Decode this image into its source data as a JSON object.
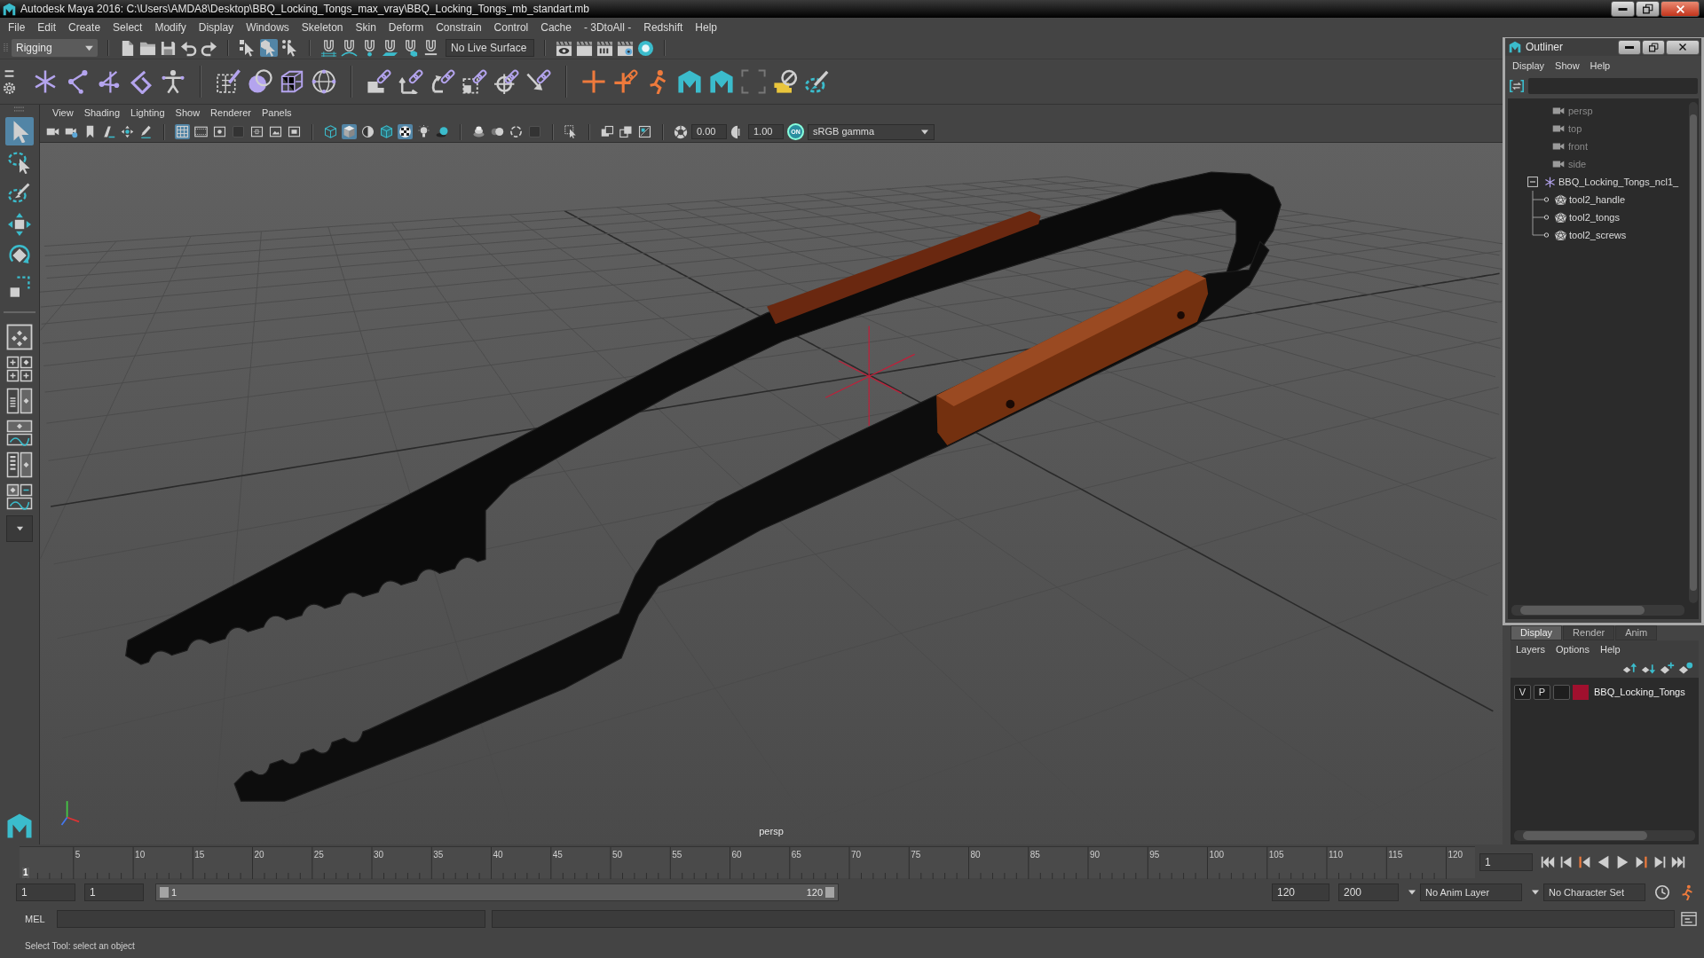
{
  "window": {
    "title": "Autodesk Maya 2016: C:\\Users\\AMDA8\\Desktop\\BBQ_Locking_Tongs_max_vray\\BBQ_Locking_Tongs_mb_standart.mb"
  },
  "menu_bar": [
    "File",
    "Edit",
    "Create",
    "Select",
    "Modify",
    "Display",
    "Windows",
    "Skeleton",
    "Skin",
    "Deform",
    "Constrain",
    "Control",
    "Cache",
    "- 3DtoAll -",
    "Redshift",
    "Help"
  ],
  "status_line": {
    "menu_set": "Rigging",
    "select_modes": [
      {
        "kind": "hierarchy",
        "selected": false
      },
      {
        "kind": "object",
        "selected": true
      },
      {
        "kind": "component",
        "selected": false
      }
    ],
    "live_surface": "No Live Surface"
  },
  "tool_box": [
    {
      "kind": "select",
      "selected": true
    },
    {
      "kind": "lasso",
      "selected": false
    },
    {
      "kind": "paint",
      "selected": false
    },
    {
      "kind": "move",
      "selected": false
    },
    {
      "kind": "rotate",
      "selected": false
    },
    {
      "kind": "scale",
      "selected": false
    }
  ],
  "viewport": {
    "menus": [
      "View",
      "Shading",
      "Lighting",
      "Show",
      "Renderer",
      "Panels"
    ],
    "toolbar": [
      [
        {
          "kind": "camera",
          "on": false
        },
        {
          "kind": "camera_attr",
          "on": false
        },
        {
          "kind": "bookmark",
          "on": false
        },
        {
          "kind": "image_plane",
          "on": false
        },
        {
          "kind": "pan_zoom",
          "on": false
        },
        {
          "kind": "grease_pencil",
          "on": false
        }
      ],
      [
        {
          "kind": "grid",
          "on": true
        },
        {
          "kind": "film_gate",
          "on": false
        },
        {
          "kind": "resolution_gate",
          "on": false
        },
        {
          "kind": "gate_mask",
          "on": false
        },
        {
          "kind": "field_chart",
          "on": false
        },
        {
          "kind": "safe_action",
          "on": false
        },
        {
          "kind": "safe_title",
          "on": false
        }
      ],
      [
        {
          "kind": "wireframe",
          "on": false
        },
        {
          "kind": "smooth_shade",
          "on": true
        },
        {
          "kind": "default_material",
          "on": false
        },
        {
          "kind": "wire_on_shaded",
          "on": false
        },
        {
          "kind": "xray",
          "on": true
        },
        {
          "kind": "use_lights",
          "on": false
        },
        {
          "kind": "shadows",
          "on": false
        }
      ],
      [
        {
          "kind": "ssao",
          "on": false
        },
        {
          "kind": "motion_blur",
          "on": false
        },
        {
          "kind": "antialias",
          "on": false
        },
        {
          "kind": "dof",
          "on": false
        }
      ],
      [
        {
          "kind": "isolate",
          "on": false
        }
      ],
      [
        {
          "kind": "xray_joints",
          "on": false
        },
        {
          "kind": "xray_active",
          "on": false
        },
        {
          "kind": "texture_res",
          "on": false
        }
      ]
    ],
    "exposure": "0.00",
    "gamma": "1.00",
    "color_management": "ON",
    "color_space": "sRGB gamma",
    "camera": "persp"
  },
  "outliner": {
    "title": "Outliner",
    "menus": [
      "Display",
      "Show",
      "Help"
    ],
    "items": [
      {
        "label": "persp",
        "kind": "camera"
      },
      {
        "label": "top",
        "kind": "camera"
      },
      {
        "label": "front",
        "kind": "camera"
      },
      {
        "label": "side",
        "kind": "camera"
      },
      {
        "label": "BBQ_Locking_Tongs_ncl1_",
        "kind": "group",
        "expanded": true,
        "children": [
          {
            "label": "tool2_handle",
            "kind": "mesh"
          },
          {
            "label": "tool2_tongs",
            "kind": "mesh"
          },
          {
            "label": "tool2_screws",
            "kind": "mesh"
          }
        ]
      }
    ]
  },
  "layer_editor": {
    "tabs": [
      {
        "label": "Display",
        "selected": true
      },
      {
        "label": "Render",
        "selected": false
      },
      {
        "label": "Anim",
        "selected": false
      }
    ],
    "menus": [
      "Layers",
      "Options",
      "Help"
    ],
    "layers": [
      {
        "visibility": "V",
        "playback": "P",
        "color": "#a0102e",
        "name": "BBQ_Locking_Tongs"
      }
    ]
  },
  "time_slider": {
    "level": 0,
    "current_frame": "1",
    "ticks": [
      "5",
      "10",
      "15",
      "20",
      "25",
      "30",
      "35",
      "40",
      "45",
      "50",
      "55",
      "60",
      "65",
      "70",
      "75",
      "80",
      "85",
      "90",
      "95",
      "100",
      "105",
      "110",
      "115",
      "120"
    ],
    "frame_field": "1"
  },
  "range_slider": {
    "start_field": "1",
    "playback_start_field": "1",
    "level": 1,
    "handle_start": "1",
    "handle_end": "120",
    "playback_end_field": "120",
    "end_field": "200"
  },
  "anim_layer": "No Anim Layer",
  "character_set": "No Character Set",
  "command_line": {
    "language": "MEL"
  },
  "help_line": "Select Tool: select an object"
}
